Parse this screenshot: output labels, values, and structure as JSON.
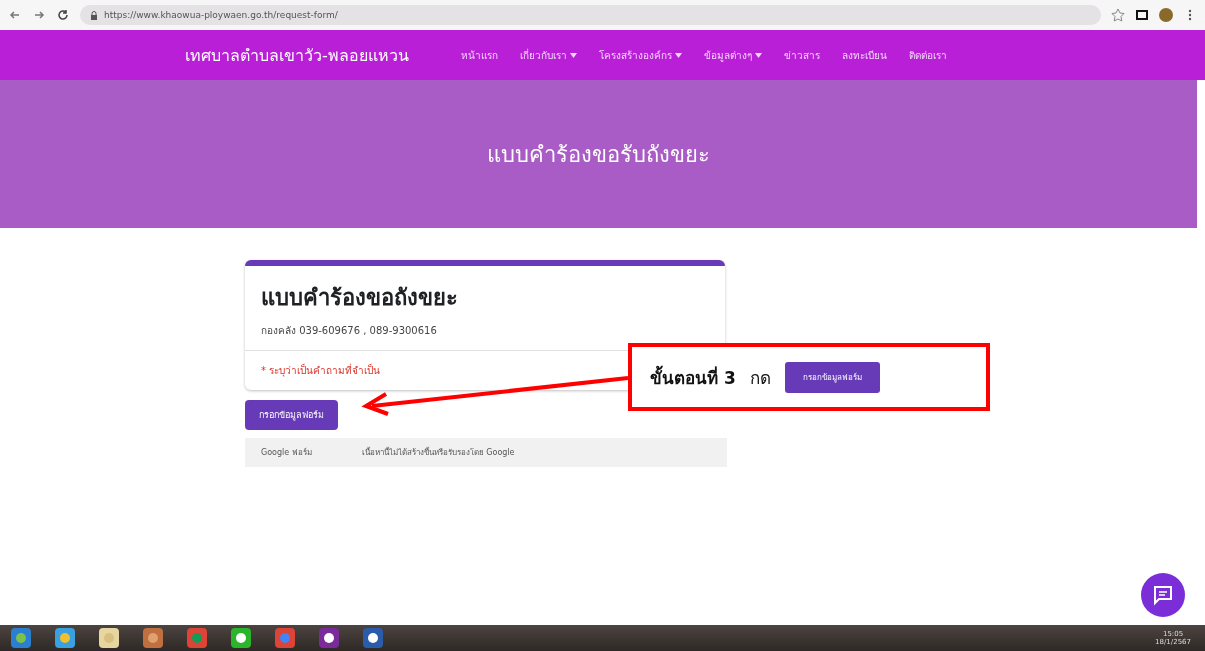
{
  "browser": {
    "url": "https://www.khaowua-ploywaen.go.th/request-form/"
  },
  "site": {
    "title": "เทศบาลตำบลเขาวัว-พลอยแหวน",
    "nav": [
      {
        "label": "หน้าแรก",
        "dropdown": false
      },
      {
        "label": "เกี่ยวกับเรา",
        "dropdown": true
      },
      {
        "label": "โครงสร้างองค์กร",
        "dropdown": true
      },
      {
        "label": "ข้อมูลต่างๆ",
        "dropdown": true
      },
      {
        "label": "ข่าวสาร",
        "dropdown": false
      },
      {
        "label": "ลงทะเบียน",
        "dropdown": false
      },
      {
        "label": "ติดต่อเรา",
        "dropdown": false
      }
    ]
  },
  "hero": {
    "title": "แบบคำร้องขอรับถังขยะ"
  },
  "form": {
    "title": "แบบคำร้องขอถังขยะ",
    "subtitle": "กองคลัง 039-609676 , 089-9300616",
    "required_note": "* ระบุว่าเป็นคำถามที่จำเป็น",
    "button": "กรอกข้อมูลฟอร์ม",
    "footer_brand": "Google ฟอร์ม",
    "footer_note": "เนื้อหานี้ไม่ได้สร้างขึ้นหรือรับรองโดย Google"
  },
  "annotation": {
    "step": "ขั้นตอนที่ 3",
    "action": "กด",
    "button": "กรอกข้อมูลฟอร์ม"
  },
  "taskbar": {
    "time": "15:05",
    "date": "18/1/2567"
  }
}
